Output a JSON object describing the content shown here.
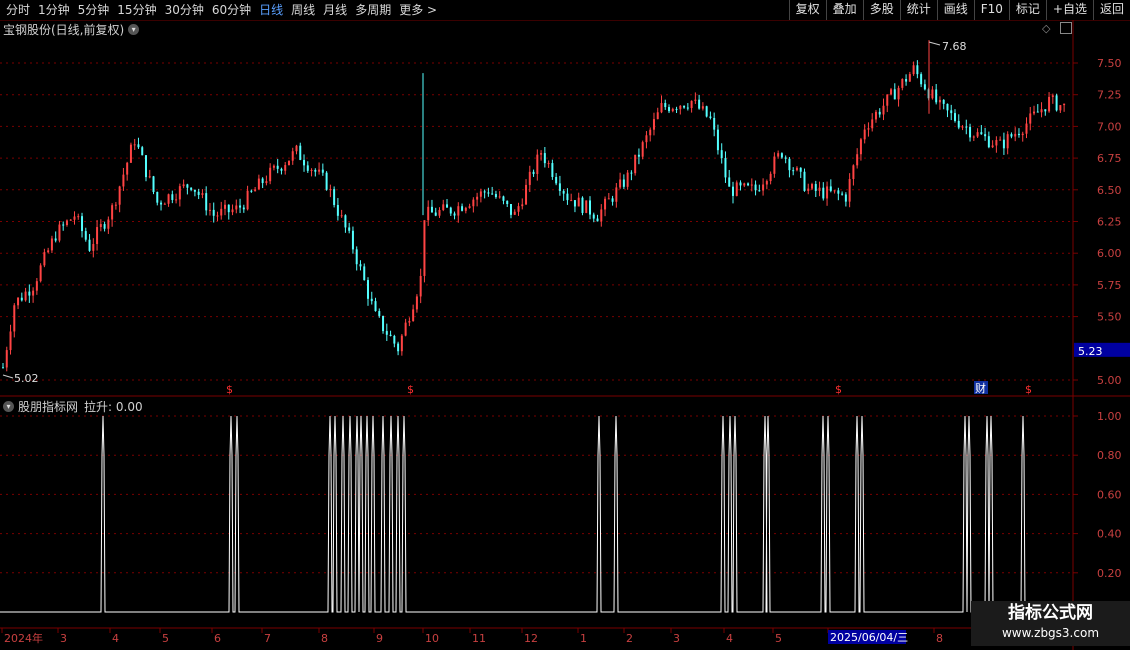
{
  "toolbar": {
    "periods": [
      "分时",
      "1分钟",
      "5分钟",
      "15分钟",
      "30分钟",
      "60分钟",
      "日线",
      "周线",
      "月线",
      "多周期",
      "更多 >"
    ],
    "active_period": "日线",
    "right_buttons": [
      "复权",
      "叠加",
      "多股",
      "统计",
      "画线",
      "F10",
      "标记",
      "+自选",
      "返回"
    ]
  },
  "main_panel": {
    "title": "宝钢股份(日线,前复权)",
    "price_axis": [
      "7.50",
      "7.25",
      "7.00",
      "6.75",
      "6.50",
      "6.25",
      "6.00",
      "5.75",
      "5.50",
      "5.23",
      "5.00"
    ],
    "current_price": "5.23",
    "high_label": "7.68",
    "low_label": "5.02",
    "event_markers": [
      "$",
      "$",
      "$",
      "财",
      "$"
    ]
  },
  "indicator_panel": {
    "title": "股朋指标网",
    "value_label": "拉升: 0.00",
    "axis": [
      "1.00",
      "0.80",
      "0.60",
      "0.40",
      "0.20"
    ]
  },
  "date_axis": {
    "labels": [
      "2024年",
      "3",
      "4",
      "5",
      "6",
      "7",
      "8",
      "9",
      "10",
      "11",
      "12",
      "1",
      "2",
      "3",
      "4",
      "5",
      "2025/06/04/三",
      "8"
    ]
  },
  "watermark": {
    "line1": "指标公式网",
    "line2": "www.zbgs3.com"
  },
  "colors": {
    "up": "#ff4444",
    "down": "#54ffff",
    "grid": "#7a0000",
    "axis_text": "#c84040",
    "highlight": "#0000a0"
  },
  "chart_data": {
    "type": "candlestick",
    "title": "宝钢股份(日线,前复权)",
    "ylim": [
      4.9,
      7.8
    ],
    "high": 7.68,
    "low": 5.02,
    "last": 5.23,
    "indicator": {
      "name": "拉升",
      "ylim": [
        0,
        1.05
      ],
      "signal_months": [
        "4",
        "6",
        "8",
        "8",
        "8",
        "8",
        "8",
        "9",
        "9",
        "9",
        "9",
        "1",
        "2",
        "2",
        "4",
        "4",
        "4",
        "4",
        "5",
        "5",
        "5",
        "5",
        "6",
        "6",
        "8",
        "8",
        "9",
        "9",
        "9"
      ]
    }
  }
}
